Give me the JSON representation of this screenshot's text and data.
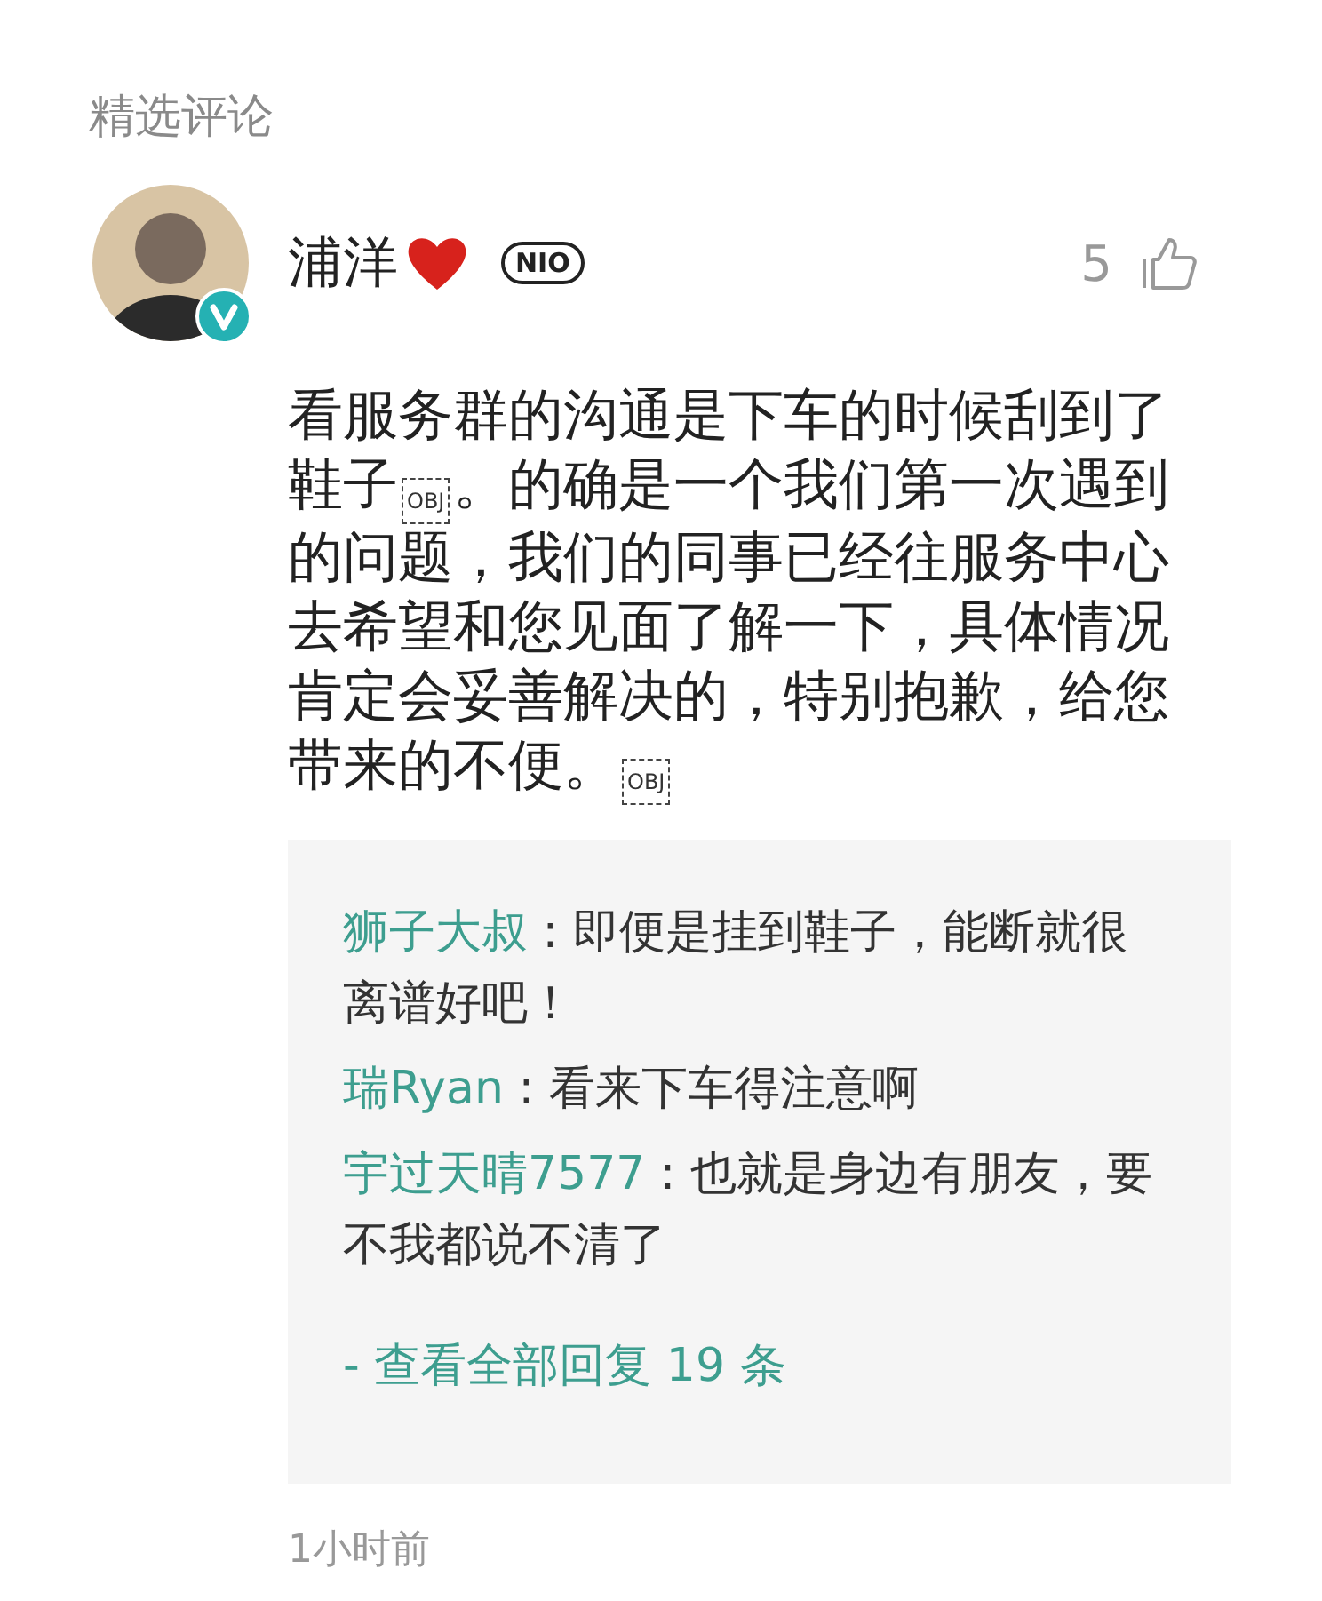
{
  "section_title": "精选评论",
  "comment": {
    "author": "浦洋",
    "badge": "NIO",
    "like_count": "5",
    "body": [
      {
        "kind": "text",
        "text": "看服务群的沟通是下车的时候刮到了鞋子"
      },
      {
        "kind": "object",
        "text": "OBJ"
      },
      {
        "kind": "text",
        "text": "。的确是一个我们第一次遇到的问题，我们的同事已经往服务中心去希望和您见面了解一下，具体情况肯定会妥善解决的，特别抱歉，给您带来的不便。"
      },
      {
        "kind": "object",
        "text": "OBJ"
      }
    ],
    "replies": [
      {
        "name": "狮子大叔",
        "separator": " : ",
        "text": "即便是挂到鞋子，能断就很离谱好吧！"
      },
      {
        "name": "瑞Ryan",
        "separator": " : ",
        "text": "看来下车得注意啊"
      },
      {
        "name": "宇过天晴7577",
        "separator": " : ",
        "text": "也就是身边有朋友，要不我都说不清了"
      }
    ],
    "view_all": "- 查看全部回复 19 条",
    "time": "1小时前"
  }
}
